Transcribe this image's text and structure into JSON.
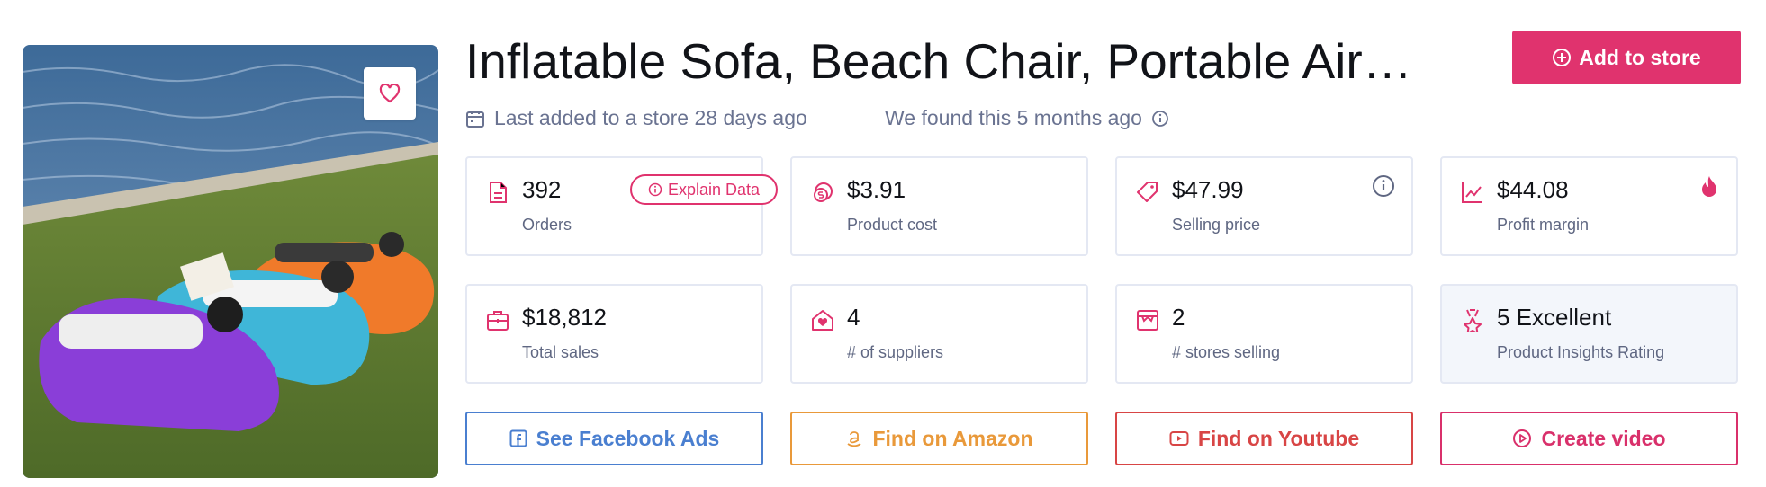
{
  "product": {
    "title": "Inflatable Sofa, Beach Chair, Portable Air …",
    "last_added": "Last added to a store 28 days ago",
    "found": "We found this 5 months ago",
    "add_button": "Add to store",
    "explain_button": "Explain Data"
  },
  "stats": [
    {
      "value": "392",
      "label": "Orders",
      "icon": "document-icon"
    },
    {
      "value": "$3.91",
      "label": "Product cost",
      "icon": "coins-icon"
    },
    {
      "value": "$47.99",
      "label": "Selling price",
      "icon": "price-tag-icon"
    },
    {
      "value": "$44.08",
      "label": "Profit margin",
      "icon": "trend-chart-icon"
    },
    {
      "value": "$18,812",
      "label": "Total sales",
      "icon": "briefcase-icon"
    },
    {
      "value": "4",
      "label": "# of suppliers",
      "icon": "house-heart-icon"
    },
    {
      "value": "2",
      "label": "# stores selling",
      "icon": "storefront-icon"
    },
    {
      "value": "5 Excellent",
      "label": "Product Insights Rating",
      "icon": "award-icon"
    }
  ],
  "actions": {
    "facebook": "See Facebook Ads",
    "amazon": "Find on Amazon",
    "youtube": "Find on Youtube",
    "video": "Create video"
  },
  "colors": {
    "accent": "#e0336e",
    "facebook": "#4a7fd0",
    "amazon": "#e9993a",
    "youtube": "#d84545",
    "muted": "#6a7391"
  }
}
